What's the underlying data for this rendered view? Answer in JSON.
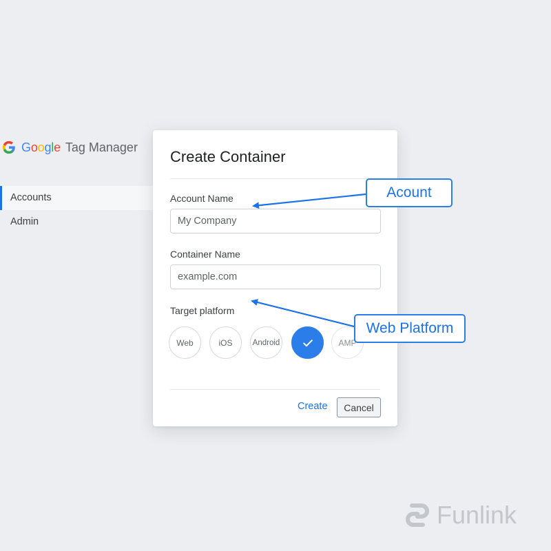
{
  "header": {
    "brand_google": "Google",
    "brand_product": "Tag Manager"
  },
  "sidebar": {
    "items": [
      {
        "label": "Accounts",
        "active": true
      },
      {
        "label": "Admin",
        "active": false
      }
    ]
  },
  "dialog": {
    "title": "Create Container",
    "account_name": {
      "label": "Account Name",
      "value": "My Company"
    },
    "container_name": {
      "label": "Container Name",
      "value": "example.com"
    },
    "target_platform": {
      "label": "Target platform",
      "options": [
        "Web",
        "iOS",
        "Android",
        "",
        "AMP"
      ],
      "selected_index": 3,
      "selected_icon": "checkmark-icon"
    },
    "create_label": "Create",
    "cancel_label": "Cancel"
  },
  "annotations": {
    "account_callout": "Acount",
    "web_callout": "Web Platform"
  },
  "watermark": {
    "text": "Funlink",
    "icon": "funlink-logo-icon"
  },
  "colors": {
    "accent": "#1a73e8",
    "selected_platform": "#2b7de9",
    "background": "#eceef1",
    "watermark": "#c3c6ca"
  }
}
